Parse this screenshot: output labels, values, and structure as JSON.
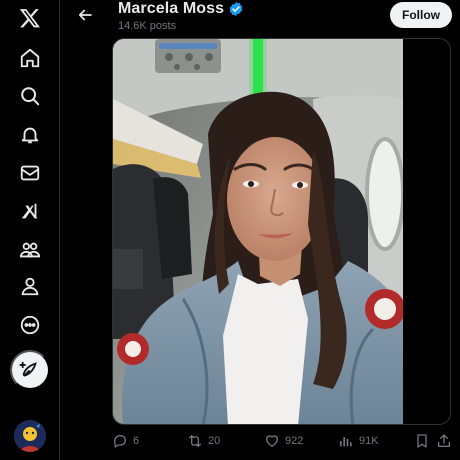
{
  "nav": {
    "items": [
      {
        "name": "x-logo-icon"
      },
      {
        "name": "home-icon"
      },
      {
        "name": "search-icon"
      },
      {
        "name": "notifications-icon"
      },
      {
        "name": "messages-icon"
      },
      {
        "name": "grok-icon"
      },
      {
        "name": "communities-icon"
      },
      {
        "name": "profile-icon"
      },
      {
        "name": "more-icon"
      }
    ],
    "compose_icon": "feather-plus-icon"
  },
  "header": {
    "name": "Marcela Moss",
    "posts_count": "14.6K posts",
    "follow_label": "Follow"
  },
  "post": {
    "replies": "6",
    "reposts": "20",
    "likes": "922",
    "views": "91K"
  },
  "colors": {
    "background": "#000000",
    "text_primary": "#e7e9ea",
    "text_secondary": "#71767b",
    "verified": "#1d9bf0",
    "follow_bg": "#eff3f4",
    "divider": "#2f3336"
  }
}
